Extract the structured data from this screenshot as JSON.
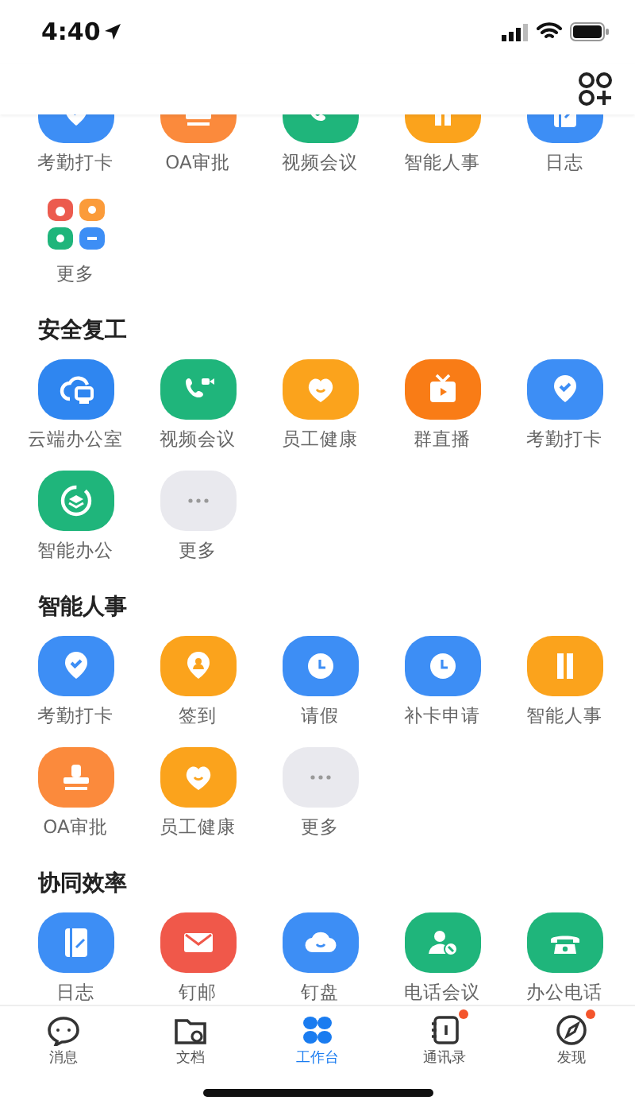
{
  "status_bar": {
    "time": "4:40"
  },
  "sections": [
    {
      "items": [
        {
          "label": "考勤打卡",
          "kind": "checkin",
          "color": "#3d8ef5"
        },
        {
          "label": "OA审批",
          "kind": "approval",
          "color": "#fb8a3c"
        },
        {
          "label": "视频会议",
          "kind": "video",
          "color": "#1fb57b"
        },
        {
          "label": "智能人事",
          "kind": "hr",
          "color": "#fba31c"
        },
        {
          "label": "日志",
          "kind": "log",
          "color": "#3d8ef5"
        },
        {
          "label": "更多",
          "kind": "apps"
        }
      ]
    },
    {
      "title": "安全复工",
      "items": [
        {
          "label": "云端办公室",
          "kind": "cloudoffice",
          "color": "#2f86f0"
        },
        {
          "label": "视频会议",
          "kind": "video",
          "color": "#1fb57b"
        },
        {
          "label": "员工健康",
          "kind": "health",
          "color": "#fba31c"
        },
        {
          "label": "群直播",
          "kind": "live",
          "color": "#f97c16"
        },
        {
          "label": "考勤打卡",
          "kind": "checkin",
          "color": "#3d8ef5"
        },
        {
          "label": "智能办公",
          "kind": "smart",
          "color": "#1fb57b"
        },
        {
          "label": "更多",
          "kind": "more",
          "color": "#e9e9ee"
        }
      ]
    },
    {
      "title": "智能人事",
      "items": [
        {
          "label": "考勤打卡",
          "kind": "checkin",
          "color": "#3d8ef5"
        },
        {
          "label": "签到",
          "kind": "signin",
          "color": "#fba31c"
        },
        {
          "label": "请假",
          "kind": "clock",
          "color": "#3d8ef5"
        },
        {
          "label": "补卡申请",
          "kind": "clock",
          "color": "#3d8ef5"
        },
        {
          "label": "智能人事",
          "kind": "hr",
          "color": "#fba31c"
        },
        {
          "label": "OA审批",
          "kind": "approval",
          "color": "#fb8a3c"
        },
        {
          "label": "员工健康",
          "kind": "health",
          "color": "#fba31c"
        },
        {
          "label": "更多",
          "kind": "more",
          "color": "#e9e9ee"
        }
      ]
    },
    {
      "title": "协同效率",
      "items": [
        {
          "label": "日志",
          "kind": "log",
          "color": "#3d8ef5"
        },
        {
          "label": "钉邮",
          "kind": "mail",
          "color": "#f0584a"
        },
        {
          "label": "钉盘",
          "kind": "drive",
          "color": "#3d8ef5"
        },
        {
          "label": "电话会议",
          "kind": "conference",
          "color": "#1fb57b"
        },
        {
          "label": "办公电话",
          "kind": "phone",
          "color": "#1fb57b"
        }
      ]
    }
  ],
  "tabs": [
    {
      "label": "消息",
      "kind": "chat",
      "selected": false,
      "badge": false
    },
    {
      "label": "文档",
      "kind": "folder",
      "selected": false,
      "badge": false
    },
    {
      "label": "工作台",
      "kind": "grid",
      "selected": true,
      "badge": false
    },
    {
      "label": "通讯录",
      "kind": "contacts",
      "selected": false,
      "badge": true
    },
    {
      "label": "发现",
      "kind": "compass",
      "selected": false,
      "badge": true
    }
  ]
}
